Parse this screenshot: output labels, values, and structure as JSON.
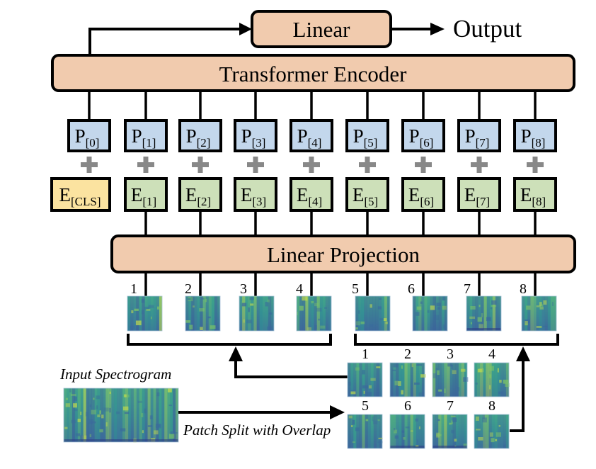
{
  "title_blocks": {
    "linear_head": "Linear",
    "output": "Output",
    "transformer_encoder": "Transformer Encoder",
    "linear_projection": "Linear Projection"
  },
  "positional_embeddings": [
    {
      "base": "P",
      "sub": "[0]"
    },
    {
      "base": "P",
      "sub": "[1]"
    },
    {
      "base": "P",
      "sub": "[2]"
    },
    {
      "base": "P",
      "sub": "[3]"
    },
    {
      "base": "P",
      "sub": "[4]"
    },
    {
      "base": "P",
      "sub": "[5]"
    },
    {
      "base": "P",
      "sub": "[6]"
    },
    {
      "base": "P",
      "sub": "[7]"
    },
    {
      "base": "P",
      "sub": "[8]"
    }
  ],
  "patch_embeddings": [
    {
      "base": "E",
      "sub": "[CLS]",
      "kind": "cls"
    },
    {
      "base": "E",
      "sub": "[1]",
      "kind": "patch"
    },
    {
      "base": "E",
      "sub": "[2]",
      "kind": "patch"
    },
    {
      "base": "E",
      "sub": "[3]",
      "kind": "patch"
    },
    {
      "base": "E",
      "sub": "[4]",
      "kind": "patch"
    },
    {
      "base": "E",
      "sub": "[5]",
      "kind": "patch"
    },
    {
      "base": "E",
      "sub": "[6]",
      "kind": "patch"
    },
    {
      "base": "E",
      "sub": "[7]",
      "kind": "patch"
    },
    {
      "base": "E",
      "sub": "[8]",
      "kind": "patch"
    }
  ],
  "plus_symbol": "+",
  "projected_patches": [
    "1",
    "2",
    "3",
    "4",
    "5",
    "6",
    "7",
    "8"
  ],
  "split_grid": {
    "row1": [
      "1",
      "2",
      "3",
      "4"
    ],
    "row2": [
      "5",
      "6",
      "7",
      "8"
    ]
  },
  "input_label": "Input Spectrogram",
  "split_label": "Patch Split with Overlap",
  "colors": {
    "block_fill": "#f1cbae",
    "position_fill": "#c3d7ec",
    "embedding_fill": "#cde0b9",
    "cls_fill": "#fbe3a0",
    "plus": "#888888",
    "spectrogram_low": "#3e5e9a",
    "spectrogram_mid": "#2f9a8c",
    "spectrogram_high": "#c8e04a"
  }
}
